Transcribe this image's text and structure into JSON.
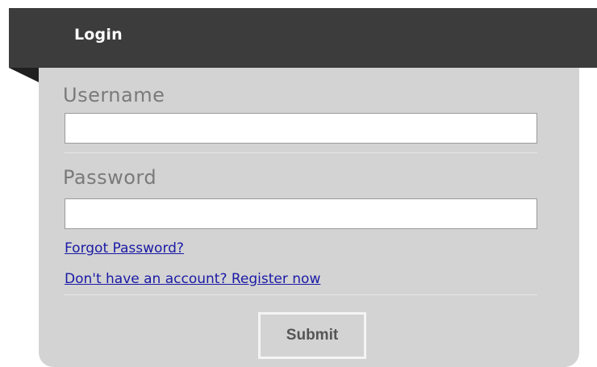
{
  "header": {
    "title": "Login"
  },
  "form": {
    "username_label": "Username",
    "username_value": "",
    "password_label": "Password",
    "password_value": "",
    "forgot_password_link": "Forgot Password?",
    "register_link": "Don't have an account? Register now",
    "submit_label": "Submit"
  },
  "colors": {
    "header_bg": "#3c3c3c",
    "panel_bg": "#d3d3d3",
    "link": "#1a1aa6",
    "label": "#7a7a7a"
  }
}
